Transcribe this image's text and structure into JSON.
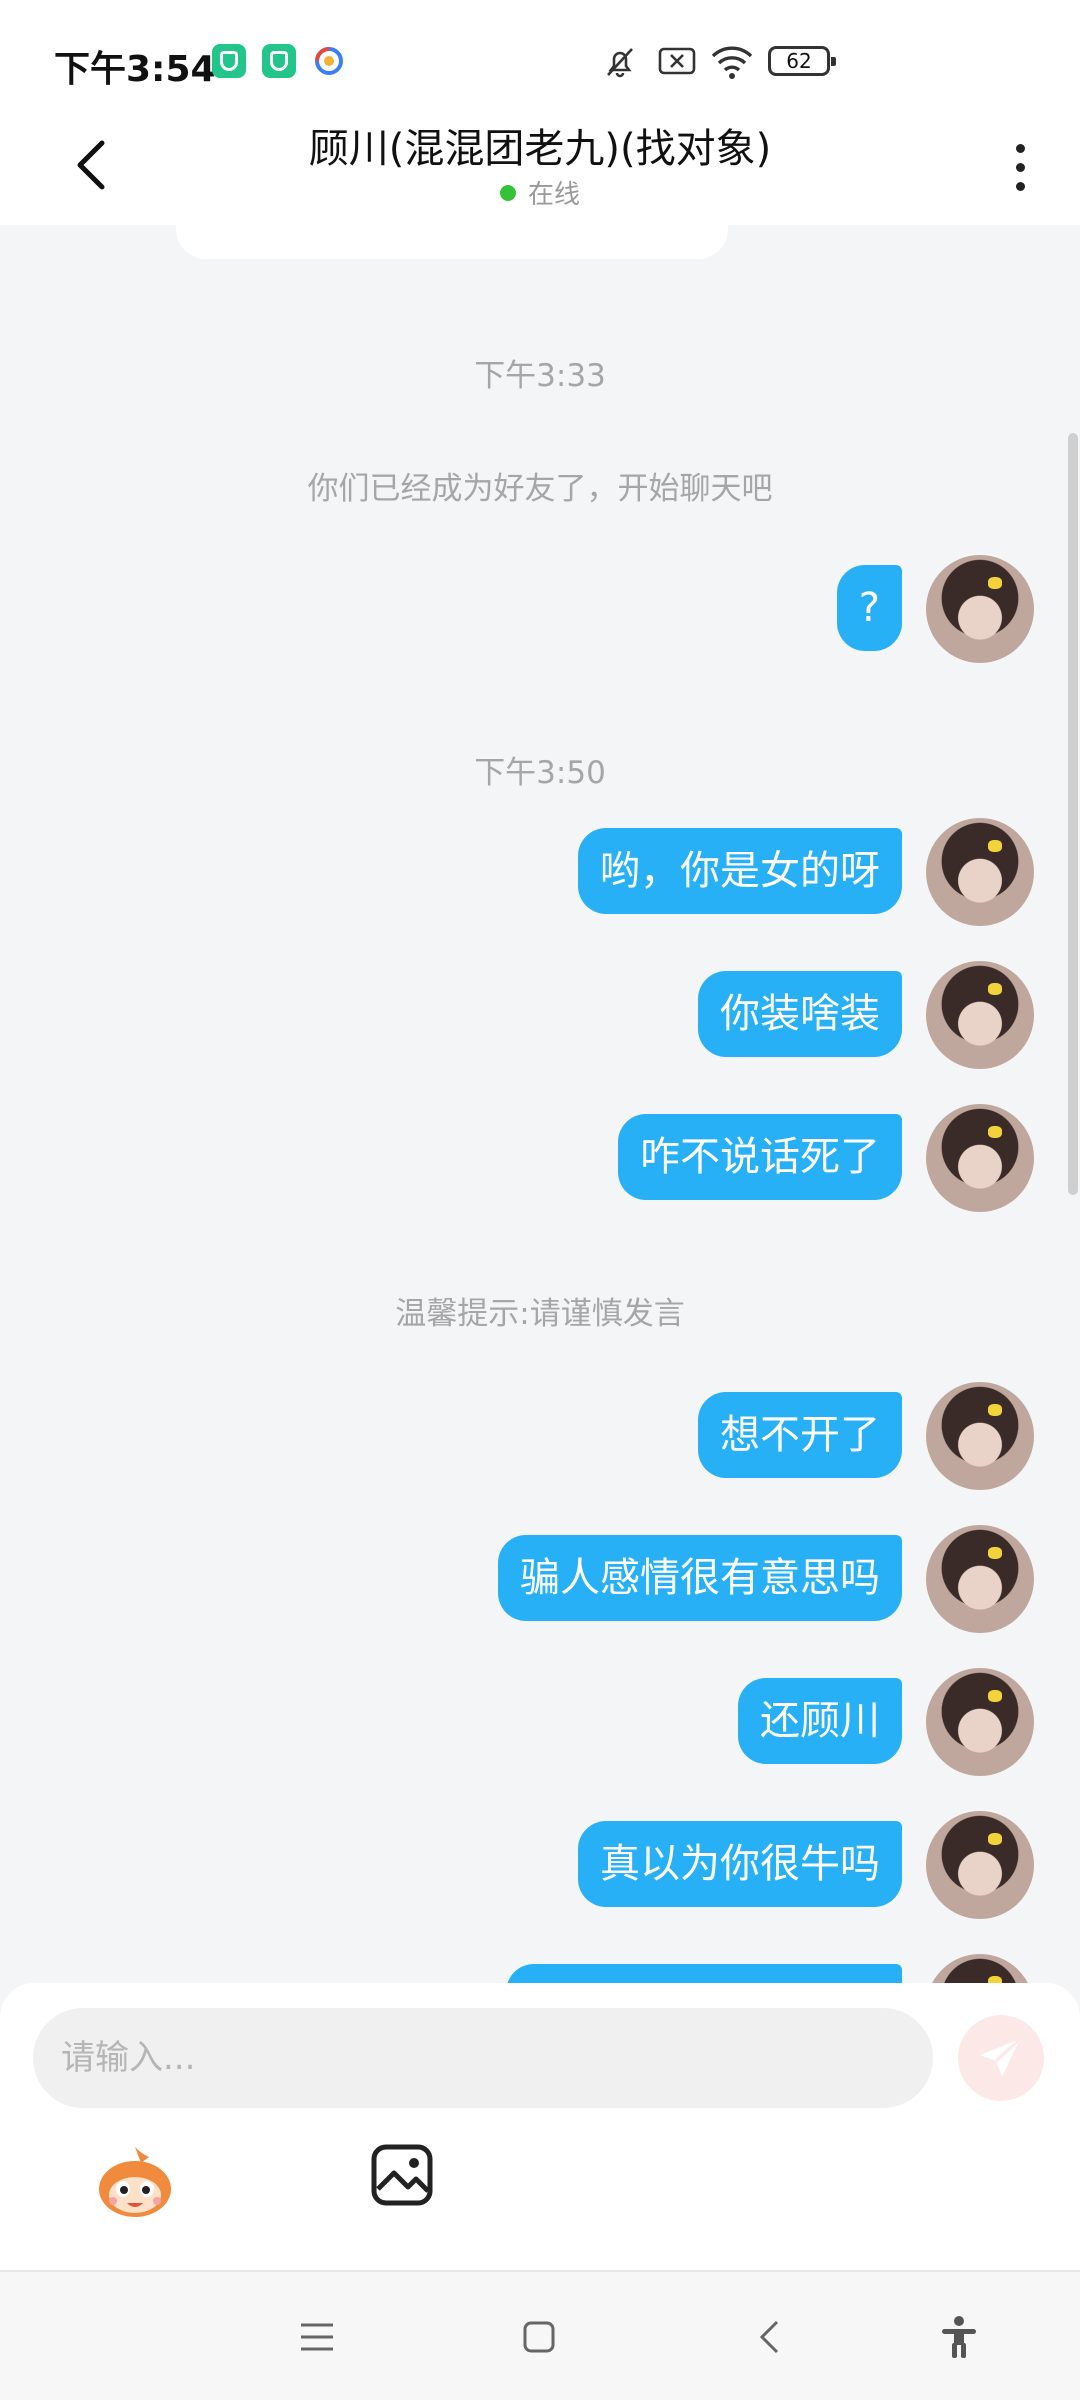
{
  "status_bar": {
    "time": "下午3:54",
    "battery": "62"
  },
  "header": {
    "title": "顾川(混混团老九)(找对象)",
    "status": "在线"
  },
  "chat": {
    "time_1": "下午3:33",
    "system_friend": "你们已经成为好友了，开始聊天吧",
    "time_2": "下午3:50",
    "tip": "温馨提示:请谨慎发言",
    "messages": [
      "?",
      "哟，你是女的呀",
      "你装啥装",
      "咋不说话死了",
      "想不开了",
      "骗人感情很有意思吗",
      "还顾川",
      "真以为你很牛吗"
    ]
  },
  "input": {
    "placeholder": "请输入..."
  },
  "colors": {
    "bubble": "#27b0f6",
    "online": "#36c236",
    "send_button_bg": "#fde8e8"
  }
}
